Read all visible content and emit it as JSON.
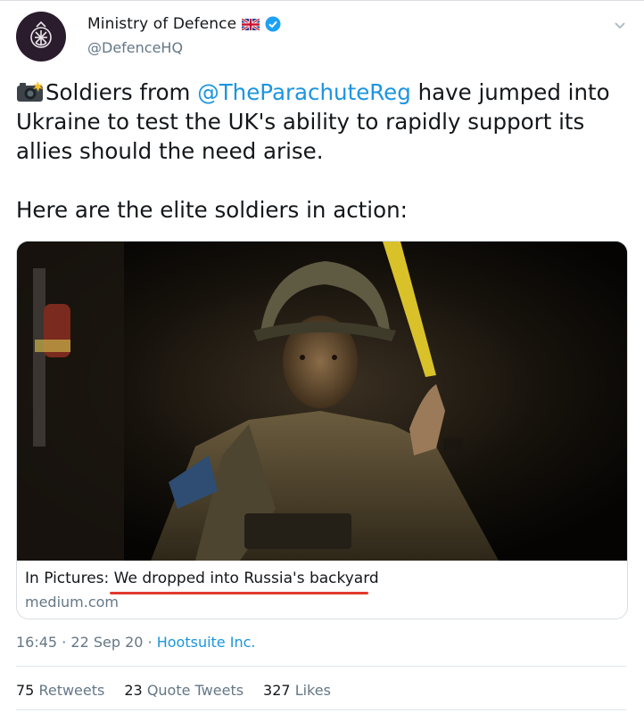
{
  "account": {
    "display_name": "Ministry of Defence",
    "handle": "@DefenceHQ",
    "flag_emoji_icon": "uk-flag-icon",
    "verified_icon": "verified-badge-icon",
    "verified_color": "#1da1f2",
    "avatar_icon": "mod-crest-icon"
  },
  "tweet": {
    "camera_icon": "camera-flash-icon",
    "line1_pre": "Soldiers from ",
    "mention": "@TheParachuteReg",
    "line1_post": " have jumped into Ukraine to test the UK's ability to rapidly support its allies should the need arise.",
    "line2": "Here are the elite soldiers in action:"
  },
  "card": {
    "title_prefix": "In Pictures: ",
    "title_main": "We dropped into Russia's backyard",
    "domain": "medium.com",
    "annotation_color": "#e23a2e"
  },
  "meta": {
    "time": "16:45",
    "date": "22 Sep 20",
    "separator": "·",
    "source": "Hootsuite Inc."
  },
  "stats": {
    "retweets_count": "75",
    "retweets_label": "Retweets",
    "quotes_count": "23",
    "quotes_label": "Quote Tweets",
    "likes_count": "327",
    "likes_label": "Likes"
  },
  "colors": {
    "link": "#1b95e0",
    "secondary_text": "#657786",
    "primary_text": "#14171a"
  }
}
